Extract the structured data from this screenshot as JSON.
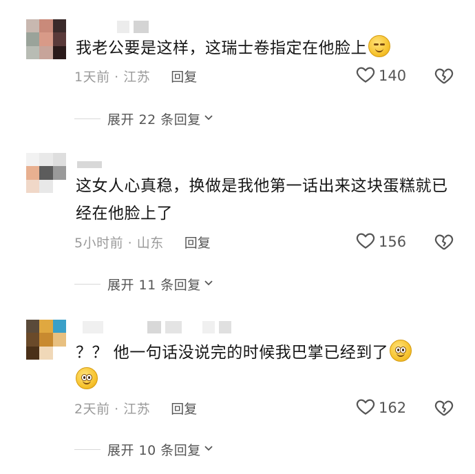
{
  "comments": [
    {
      "text": "我老公要是这样，这瑞士卷指定在他脸上",
      "emoji_after": "smirk-emoji",
      "time": "1天前 · 江苏",
      "reply_label": "回复",
      "likes": "140",
      "expand_label": "展开 22 条回复"
    },
    {
      "text": "这女人心真稳，换做是我他第一话出来这块蛋糕就已经在他脸上了",
      "time": "5小时前 · 山东",
      "reply_label": "回复",
      "likes": "156",
      "expand_label": "展开 11 条回复"
    },
    {
      "text": "？？ 他一句话没说完的时候我巴掌已经到了",
      "emoji_after": "smile-emoji",
      "emoji_line2": "smile-emoji",
      "time": "2天前 · 江苏",
      "reply_label": "回复",
      "likes": "162",
      "expand_label": "展开 10 条回复"
    }
  ],
  "colors": {
    "text": "#161616",
    "meta": "#9a9a9a",
    "action": "#555555",
    "divider": "#d8d8d8"
  },
  "icons": {
    "like": "heart-outline-icon",
    "dislike": "broken-heart-icon",
    "expand": "chevron-down-icon"
  }
}
